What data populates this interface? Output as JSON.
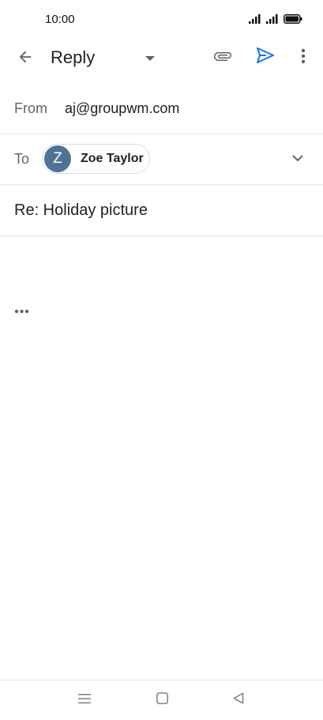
{
  "status_bar": {
    "time": "10:00",
    "icons": [
      "signal-icon",
      "signal-icon",
      "battery-icon"
    ]
  },
  "app_bar": {
    "title": "Reply",
    "icons": [
      "back-arrow-icon",
      "dropdown-caret-icon",
      "attachment-icon",
      "send-icon",
      "more-vert-icon"
    ],
    "send_color": "#1a73e8"
  },
  "compose": {
    "from_label": "From",
    "from_value": "aj@groupwm.com",
    "to_label": "To",
    "recipient": {
      "initial": "Z",
      "name": "Zoe Taylor",
      "avatar_color": "#4f7394"
    },
    "subject": "Re: Holiday picture",
    "quoted_text_toggle": "show-quoted-text-icon"
  },
  "nav_bar": {
    "icons": [
      "menu-icon",
      "home-icon",
      "back-triangle-icon"
    ]
  }
}
